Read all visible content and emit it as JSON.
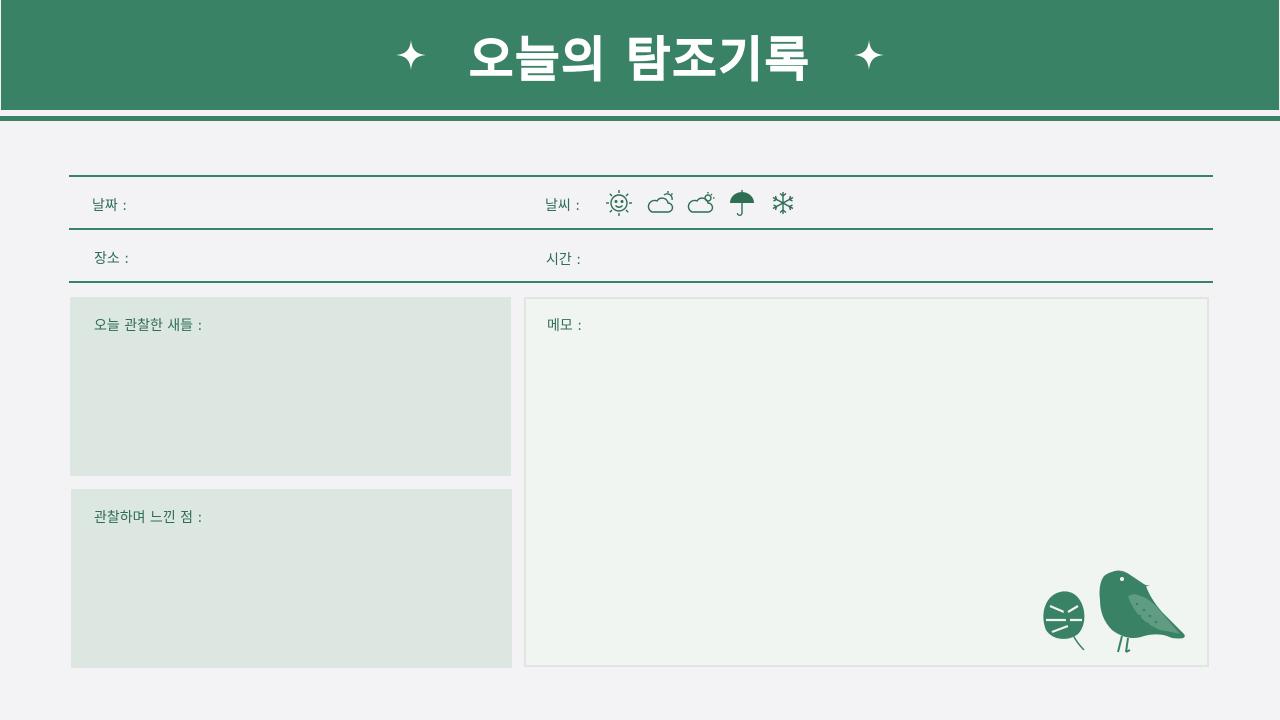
{
  "header": {
    "title": "오늘의 탐조기록",
    "left_icon": "sparkle-icon",
    "right_icon": "sparkle-icon"
  },
  "fields": {
    "date_label": "날짜 :",
    "weather_label": "날씨 :",
    "place_label": "장소 :",
    "time_label": "시간 :"
  },
  "weather_icons": [
    "sun-icon",
    "cloud-sun-icon",
    "cloud-sun-small-icon",
    "umbrella-icon",
    "snowflake-icon"
  ],
  "boxes": {
    "birds_label": "오늘 관찰한 새들 :",
    "feelings_label": "관찰하며 느낀 점 :",
    "memo_label": "메모 :"
  },
  "decoration": [
    "leaf-icon",
    "bird-icon"
  ],
  "colors": {
    "primary": "#3a8265",
    "box_fill": "#dce7e1",
    "background": "#f3f2f5"
  }
}
